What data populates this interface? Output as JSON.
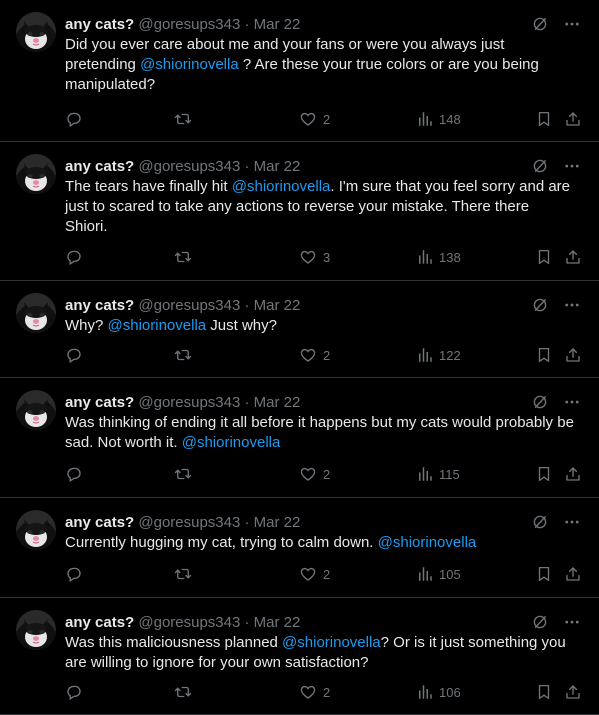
{
  "colors": {
    "background": "#000000",
    "text": "#e7e9ea",
    "muted": "#71767b",
    "link": "#1d9bf0",
    "divider": "#2f3336"
  },
  "icons": {
    "reply": "reply-icon",
    "retweet": "retweet-icon",
    "like": "heart-icon",
    "views": "views-icon",
    "bookmark": "bookmark-icon",
    "share": "share-icon",
    "grok": "grok-icon",
    "more": "more-icon"
  },
  "tweets": [
    {
      "name": "any cats?",
      "handle": "@goresups343",
      "sep": "·",
      "date": "Mar 22",
      "segments": [
        {
          "text": "Did you ever care about me and your fans or were you always just pretending "
        },
        {
          "text": "@shiorinovella",
          "mention": true
        },
        {
          "text": " ? Are these your true colors or are you being manipulated?"
        }
      ],
      "likes": "2",
      "views": "148"
    },
    {
      "name": "any cats?",
      "handle": "@goresups343",
      "sep": "·",
      "date": "Mar 22",
      "segments": [
        {
          "text": "The tears have finally hit "
        },
        {
          "text": "@shiorinovella",
          "mention": true
        },
        {
          "text": ". I'm sure that you feel sorry and are just to scared to take any actions to reverse your mistake. There there Shiori."
        }
      ],
      "likes": "3",
      "views": "138"
    },
    {
      "name": "any cats?",
      "handle": "@goresups343",
      "sep": "·",
      "date": "Mar 22",
      "segments": [
        {
          "text": "Why? "
        },
        {
          "text": "@shiorinovella",
          "mention": true
        },
        {
          "text": " Just why?"
        }
      ],
      "likes": "2",
      "views": "122"
    },
    {
      "name": "any cats?",
      "handle": "@goresups343",
      "sep": "·",
      "date": "Mar 22",
      "segments": [
        {
          "text": "Was thinking of ending it all before it happens but my cats would probably be sad. Not worth it. "
        },
        {
          "text": "@shiorinovella",
          "mention": true
        }
      ],
      "likes": "2",
      "views": "115"
    },
    {
      "name": "any cats?",
      "handle": "@goresups343",
      "sep": "·",
      "date": "Mar 22",
      "segments": [
        {
          "text": "Currently hugging my cat, trying to calm down. "
        },
        {
          "text": "@shiorinovella",
          "mention": true
        }
      ],
      "likes": "2",
      "views": "105"
    },
    {
      "name": "any cats?",
      "handle": "@goresups343",
      "sep": "·",
      "date": "Mar 22",
      "segments": [
        {
          "text": "Was this maliciousness planned "
        },
        {
          "text": "@shiorinovella",
          "mention": true
        },
        {
          "text": "? Or is it just something you are willing to ignore for your own satisfaction?"
        }
      ],
      "likes": "2",
      "views": "106"
    }
  ]
}
